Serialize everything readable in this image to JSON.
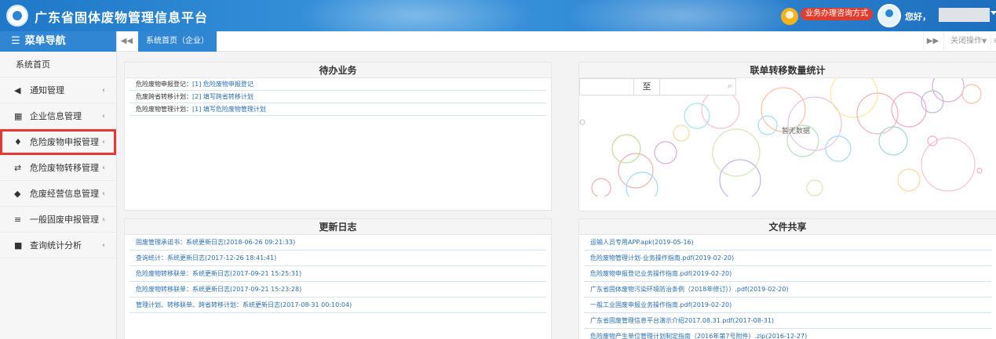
{
  "header": {
    "title": "广东省固体废物管理信息平台",
    "hotline_label": "业务办理咨询方式",
    "greeting": "您好，",
    "user_name": ""
  },
  "sidebar": {
    "menu_title": "菜单导航",
    "items": [
      {
        "label": "系统首页",
        "icon": "home"
      },
      {
        "label": "通知管理",
        "icon": "megaphone-icon"
      },
      {
        "label": "企业信息管理",
        "icon": "qrcode-icon"
      },
      {
        "label": "危险废物申报管理",
        "icon": "pin-icon",
        "highlighted": true
      },
      {
        "label": "危险废物转移管理",
        "icon": "exchange-icon"
      },
      {
        "label": "危废经营信息管理",
        "icon": "tag-icon"
      },
      {
        "label": "一般固废申报管理",
        "icon": "sliders-icon"
      },
      {
        "label": "查询统计分析",
        "icon": "book-icon"
      }
    ]
  },
  "tabs": {
    "active": "系统首页（企业）",
    "close_ops": "关闭操作"
  },
  "todo": {
    "title": "待办业务",
    "rows": [
      {
        "label": "危险废物申报登记：",
        "link": "[1] 危险废物申报登记"
      },
      {
        "label": "危废跨省转移计划：",
        "link": "[2] 填写跨省转移计划"
      },
      {
        "label": "危险废物管理计划：",
        "link": "[1] 填写危险废物管理计划"
      }
    ]
  },
  "transfer_stats": {
    "title": "联单转移数量统计",
    "range_sep": "至",
    "no_data": "暂无数据"
  },
  "changelog": {
    "title": "更新日志",
    "rows": [
      "固废管理承诺书：系统更新日志(2018-06-26 09:21:33)",
      "查询统计：系统更新日志(2017-12-26 18:41:41)",
      "危险废物转移联单：系统更新日志(2017-09-21 15:25:31)",
      "危险废物转移联单：系统更新日志(2017-09-21 15:23:28)",
      "管理计划、转移联单、跨省转移计划：系统更新日志(2017-08-31 00:10:04)"
    ]
  },
  "files": {
    "title": "文件共享",
    "rows": [
      "运输人员专用APP.apk(2019-05-16)",
      "危险废物管理计划-业务操作指南.pdf(2019-02-20)",
      "危险废物申报登记业务操作指南.pdf(2019-02-20)",
      "广东省固体废物污染环境防治条例（2018年修订））.pdf(2019-02-20)",
      "一般工业固废申报业务操作指南.pdf(2019-02-20)",
      "广东省固废管理信息平台演示介绍2017.08.31.pdf(2017-08-31)",
      "危险废物产生单位管理计划制定指南（2016年第7号附件）.zip(2016-12-27)"
    ]
  },
  "colors": {
    "brand": "#2f86d3",
    "link": "#2a6fb0",
    "highlight_outline": "#e53935",
    "hotline_bg": "#e03d2e"
  }
}
